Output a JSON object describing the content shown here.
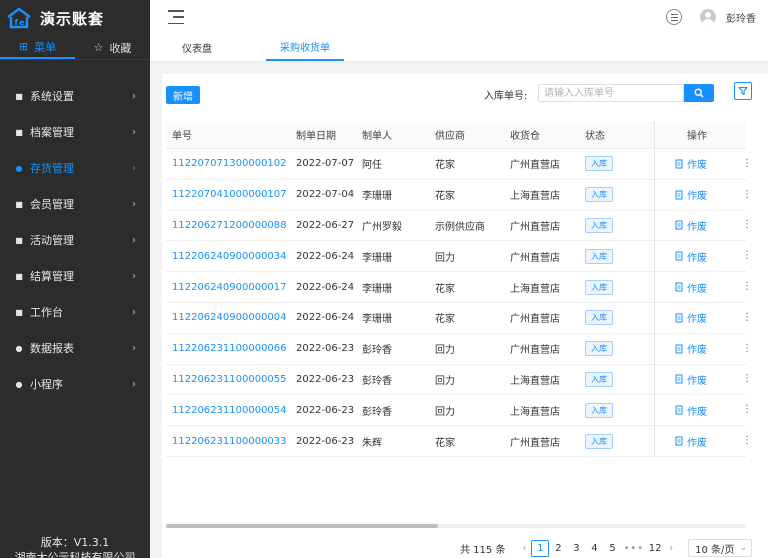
{
  "app": {
    "title": "演示账套",
    "version": "版本：V1.3.1",
    "company": "湖南大公示科技有限公司"
  },
  "sidebar": {
    "tabs": [
      {
        "label": "菜单",
        "icon": "grid-icon",
        "active": true
      },
      {
        "label": "收藏",
        "icon": "star-icon",
        "active": false
      }
    ],
    "items": [
      {
        "label": "系统设置",
        "icon": "settings-icon"
      },
      {
        "label": "档案管理",
        "icon": "archive-icon"
      },
      {
        "label": "存货管理",
        "icon": "inventory-icon",
        "active": true
      },
      {
        "label": "会员管理",
        "icon": "member-icon"
      },
      {
        "label": "活动管理",
        "icon": "gift-icon"
      },
      {
        "label": "结算管理",
        "icon": "settlement-icon"
      },
      {
        "label": "工作台",
        "icon": "workbench-icon"
      },
      {
        "label": "数据报表",
        "icon": "report-icon"
      },
      {
        "label": "小程序",
        "icon": "miniapp-icon"
      }
    ]
  },
  "header": {
    "user_name": "彭玲香"
  },
  "page_tabs": [
    {
      "label": "仪表盘",
      "active": false
    },
    {
      "label": "采购收货单",
      "active": true
    }
  ],
  "toolbar": {
    "add_label": "新增",
    "search_label": "入库单号:",
    "search_placeholder": "请输入入库单号",
    "search_value": ""
  },
  "table": {
    "columns": [
      "单号",
      "制单日期",
      "制单人",
      "供应商",
      "收货仓",
      "状态",
      "操作"
    ],
    "rows": [
      {
        "no": "112207071300000102",
        "date": "2022-07-07",
        "maker": "阿任",
        "supplier": "花家",
        "warehouse": "广州直营店",
        "status": "入库",
        "op": "作废"
      },
      {
        "no": "112207041000000107",
        "date": "2022-07-04",
        "maker": "李珊珊",
        "supplier": "花家",
        "warehouse": "上海直营店",
        "status": "入库",
        "op": "作废"
      },
      {
        "no": "112206271200000088",
        "date": "2022-06-27",
        "maker": "广州罗毅",
        "supplier": "示例供应商",
        "warehouse": "广州直营店",
        "status": "入库",
        "op": "作废"
      },
      {
        "no": "112206240900000034",
        "date": "2022-06-24",
        "maker": "李珊珊",
        "supplier": "回力",
        "warehouse": "广州直营店",
        "status": "入库",
        "op": "作废"
      },
      {
        "no": "112206240900000017",
        "date": "2022-06-24",
        "maker": "李珊珊",
        "supplier": "花家",
        "warehouse": "上海直营店",
        "status": "入库",
        "op": "作废"
      },
      {
        "no": "112206240900000004",
        "date": "2022-06-24",
        "maker": "李珊珊",
        "supplier": "花家",
        "warehouse": "广州直营店",
        "status": "入库",
        "op": "作废"
      },
      {
        "no": "112206231100000066",
        "date": "2022-06-23",
        "maker": "彭玲香",
        "supplier": "回力",
        "warehouse": "广州直营店",
        "status": "入库",
        "op": "作废"
      },
      {
        "no": "112206231100000055",
        "date": "2022-06-23",
        "maker": "彭玲香",
        "supplier": "回力",
        "warehouse": "上海直营店",
        "status": "入库",
        "op": "作废"
      },
      {
        "no": "112206231100000054",
        "date": "2022-06-23",
        "maker": "彭玲香",
        "supplier": "回力",
        "warehouse": "上海直营店",
        "status": "入库",
        "op": "作废"
      },
      {
        "no": "112206231100000033",
        "date": "2022-06-23",
        "maker": "朱辉",
        "supplier": "花家",
        "warehouse": "广州直营店",
        "status": "入库",
        "op": "作废"
      }
    ]
  },
  "pagination": {
    "total_text": "共 115 条",
    "pages": [
      "1",
      "2",
      "3",
      "4",
      "5"
    ],
    "current": "1",
    "ellipsis": "•••",
    "last": "12",
    "page_size": "10 条/页"
  },
  "colors": {
    "accent": "#1890ff",
    "sidebar_bg": "#2c2c2c"
  }
}
